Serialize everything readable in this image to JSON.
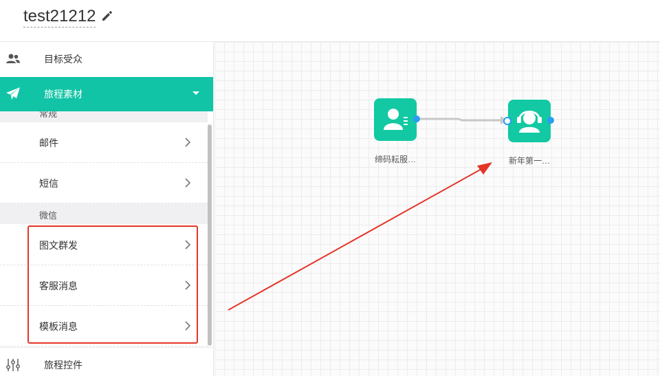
{
  "header": {
    "title": "test21212"
  },
  "sidebar": {
    "audience_label": "目标受众",
    "material_label": "旅程素材",
    "controls_label": "旅程控件",
    "groups": [
      {
        "label": "常规"
      },
      {
        "label": "微信"
      }
    ],
    "items": [
      {
        "label": "邮件"
      },
      {
        "label": "短信"
      },
      {
        "label": "图文群发"
      },
      {
        "label": "客服消息"
      },
      {
        "label": "模板消息"
      }
    ]
  },
  "canvas": {
    "nodes": [
      {
        "label": "缔码耘服…",
        "icon": "user-list-icon"
      },
      {
        "label": "新年第一…",
        "icon": "customer-service-icon"
      }
    ]
  },
  "colors": {
    "accent": "#12c4a6",
    "node": "#12c9a3",
    "port": "#2a9df4",
    "annotation": "#e53528"
  }
}
